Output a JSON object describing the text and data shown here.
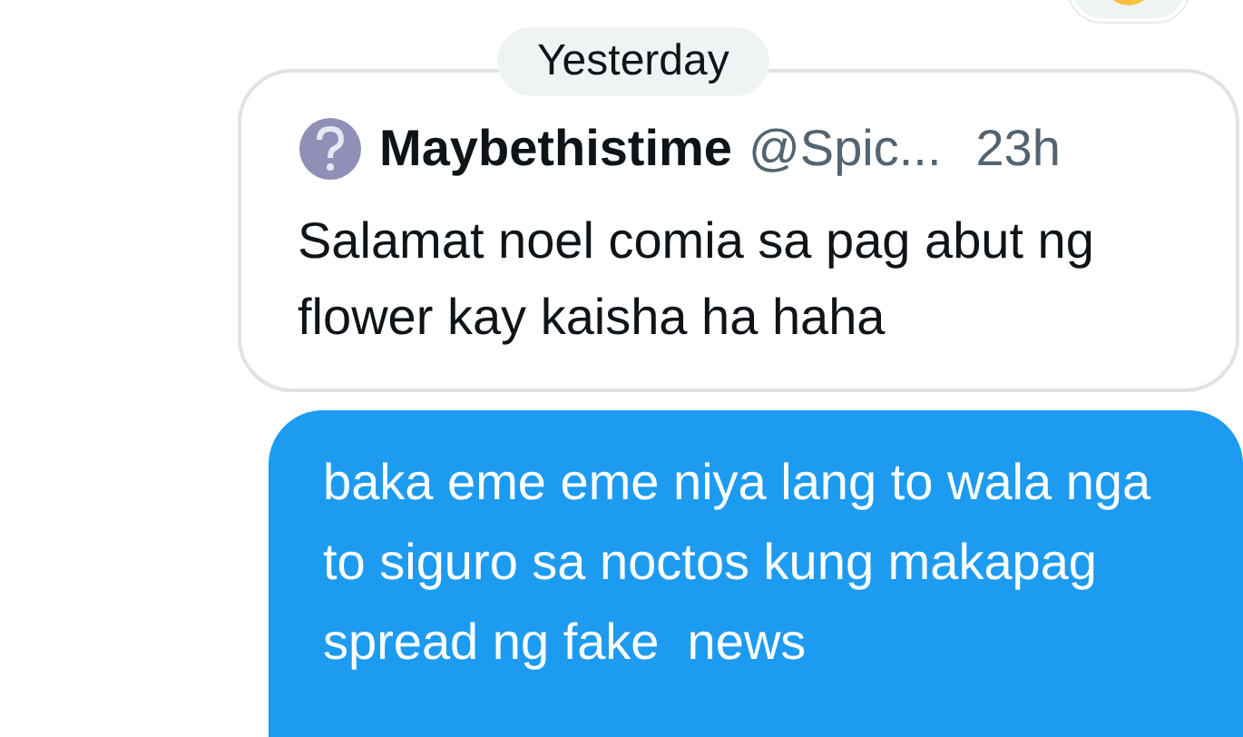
{
  "date_separator": "Yesterday",
  "quoted_post": {
    "author": "Maybethistime",
    "handle": "@Spic...",
    "time": "23h",
    "text": "Salamat noel comia sa pag abut ng flower kay kaisha ha haha"
  },
  "message": {
    "text": "baka eme eme niya lang to wala nga to siguro sa noctos kung makapag spread ng fake  news",
    "outgoing": true
  }
}
